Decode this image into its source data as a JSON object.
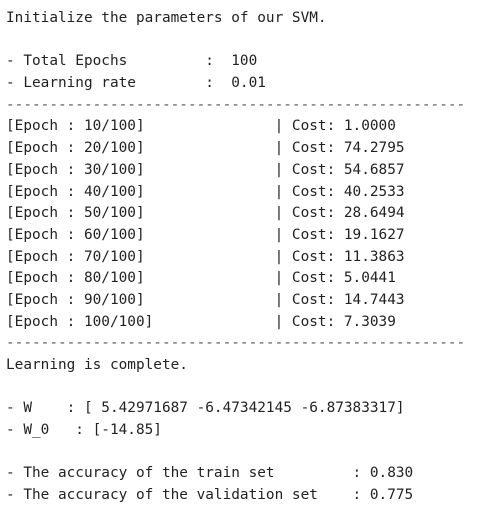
{
  "intro": "Initialize the parameters of our SVM.",
  "params": [
    "- Total Epochs         :  100",
    "- Learning rate        :  0.01"
  ],
  "separator": "-----------------------------------------------------",
  "epochs": [
    "[Epoch : 10/100]               | Cost: 1.0000",
    "[Epoch : 20/100]               | Cost: 74.2795",
    "[Epoch : 30/100]               | Cost: 54.6857",
    "[Epoch : 40/100]               | Cost: 40.2533",
    "[Epoch : 50/100]               | Cost: 28.6494",
    "[Epoch : 60/100]               | Cost: 19.1627",
    "[Epoch : 70/100]               | Cost: 11.3863",
    "[Epoch : 80/100]               | Cost: 5.0441",
    "[Epoch : 90/100]               | Cost: 14.7443",
    "[Epoch : 100/100]              | Cost: 7.3039"
  ],
  "complete": "Learning is complete.",
  "weights": [
    "- W    : [ 5.42971687 -6.47342145 -6.87383317]",
    "- W_0   : [-14.85]"
  ],
  "accuracy": [
    "- The accuracy of the train set         : 0.830",
    "- The accuracy of the validation set    : 0.775"
  ]
}
